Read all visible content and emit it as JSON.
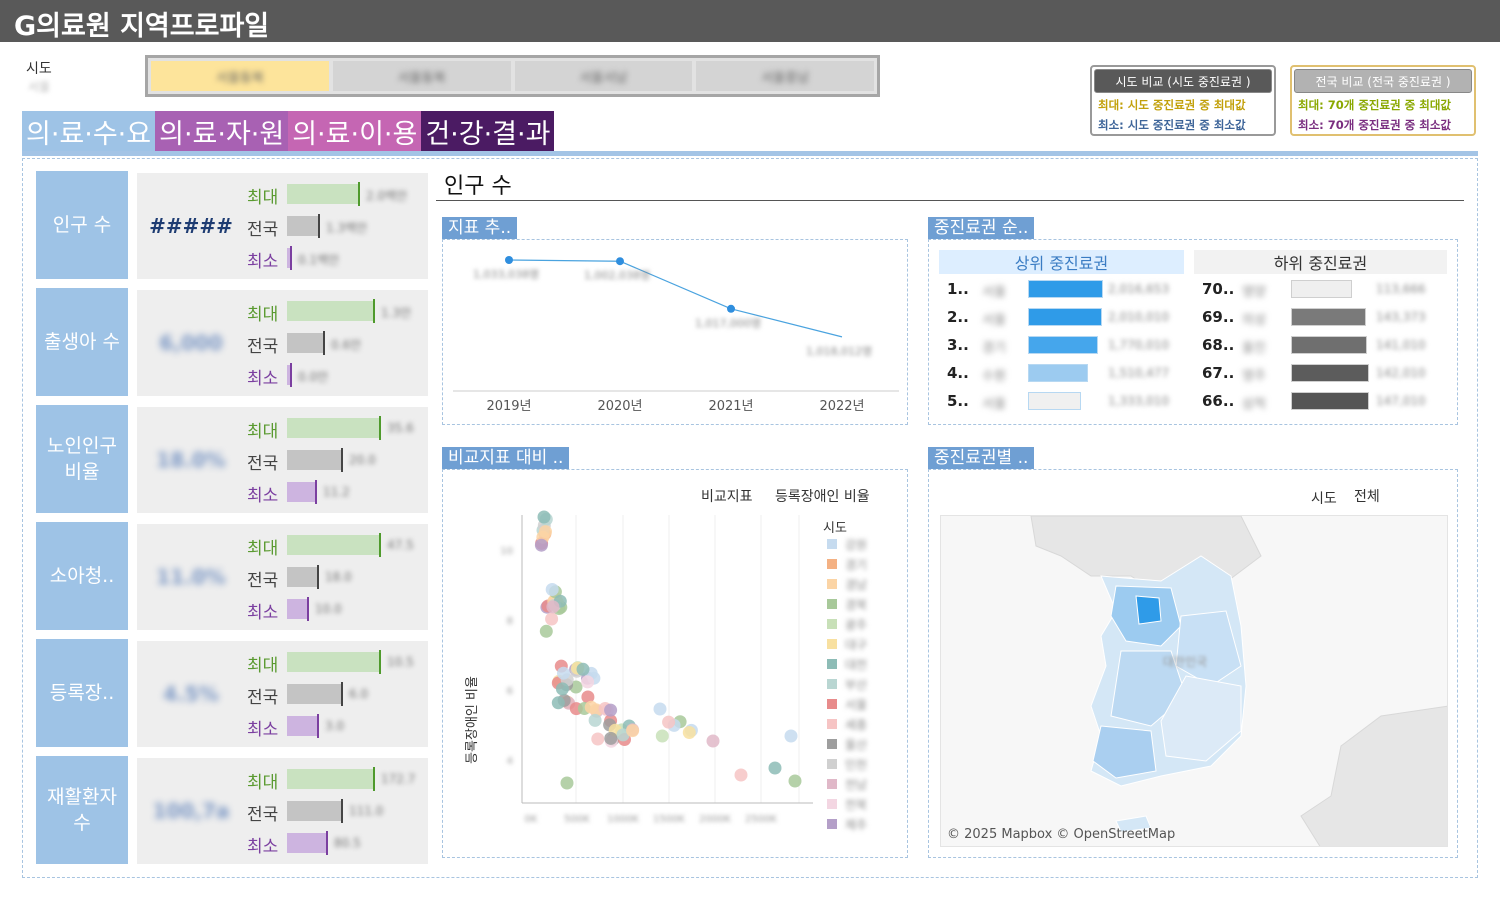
{
  "title": "G의료원 지역프로파일",
  "filter": {
    "label": "시도",
    "value": "서울"
  },
  "sido_tabs": [
    {
      "label": "서울동북",
      "active": true
    },
    {
      "label": "서울동북",
      "active": false
    },
    {
      "label": "서울서남",
      "active": false
    },
    {
      "label": "서울중남",
      "active": false
    }
  ],
  "compare_sido": {
    "header": "시도 비교 (시도 중진료권 )",
    "line_max": "최대: 시도 중진료권 중 최대값",
    "line_min": "최소: 시도 중진료권 중 최소값"
  },
  "compare_nation": {
    "header": "전국 비교 (전국 중진료권 )",
    "line_max": "최대: 70개 중진료권 중 최대값",
    "line_min": "최소: 70개 중진료권 중 최소값"
  },
  "category_tabs": [
    {
      "label": "의·료·수·요",
      "color": "#9ec3e6"
    },
    {
      "label": "의·료·자·원",
      "color": "#a861b3"
    },
    {
      "label": "의·료·이·용",
      "color": "#c566b3"
    },
    {
      "label": "건·강·결·과",
      "color": "#4b1b63"
    }
  ],
  "mm_labels": {
    "max": "최대",
    "nat": "전국",
    "min": "최소"
  },
  "indicators": [
    {
      "label": "인구 수",
      "value": "#####",
      "max_label": "2.0백만",
      "nat_label": "1.3백만",
      "min_label": "0.1백만",
      "max_pct": 0.53,
      "nat_pct": 0.23,
      "min_pct": 0.02
    },
    {
      "label": "출생아 수",
      "value": "6,000",
      "max_label": "1.3만",
      "nat_label": "0.6만",
      "min_label": "0.0만",
      "max_pct": 0.64,
      "nat_pct": 0.27,
      "min_pct": 0.02
    },
    {
      "label": "노인인구 비율",
      "value": "18.0%",
      "max_label": "35.6",
      "nat_label": "20.0",
      "min_label": "11.2",
      "max_pct": 0.68,
      "nat_pct": 0.4,
      "min_pct": 0.21
    },
    {
      "label": "소아청..",
      "value": "11.0%",
      "max_label": "47.5",
      "nat_label": "18.0",
      "min_label": "10.0",
      "max_pct": 0.68,
      "nat_pct": 0.22,
      "min_pct": 0.15
    },
    {
      "label": "등록장..",
      "value": "4.5%",
      "max_label": "10.5",
      "nat_label": "6.0",
      "min_label": "3.0",
      "max_pct": 0.68,
      "nat_pct": 0.4,
      "min_pct": 0.22
    },
    {
      "label": "재활환자 수",
      "value": "100,7a",
      "max_label": "172.7",
      "nat_label": "111.0",
      "min_label": "80.5",
      "max_pct": 0.64,
      "nat_pct": 0.4,
      "min_pct": 0.29
    }
  ],
  "section_title": "인구 수",
  "trend": {
    "header": "지표 추..",
    "chart_data": {
      "type": "line",
      "categories": [
        "2019년",
        "2020년",
        "2021년",
        "2022년"
      ],
      "values": [
        1.0,
        0.99,
        0.6,
        0.37
      ],
      "labels": [
        "1,033,038명",
        "1,002,038명",
        "1,017,000명",
        "1,018,012명"
      ]
    }
  },
  "ranking": {
    "header": "중진료권 순..",
    "top_title": "상위 중진료권",
    "bottom_title": "하위 중진료권",
    "top": [
      {
        "rank": "1..",
        "name": "서울",
        "value": "2,016,653",
        "pct": 1.0,
        "color": "#2f9be8"
      },
      {
        "rank": "2..",
        "name": "서울",
        "value": "2,010,010",
        "pct": 0.98,
        "color": "#2f9be8"
      },
      {
        "rank": "3..",
        "name": "경기",
        "value": "1,770,010",
        "pct": 0.93,
        "color": "#45a6ec"
      },
      {
        "rank": "4..",
        "name": "수원",
        "value": "1,510,477",
        "pct": 0.8,
        "color": "#9ccbf0"
      },
      {
        "rank": "5..",
        "name": "서울",
        "value": "1,333,010",
        "pct": 0.7,
        "color": "#f0f0f0"
      }
    ],
    "bottom": [
      {
        "rank": "70..",
        "name": "영양",
        "value": "113,666",
        "pct": 0.78,
        "color": "#efefef"
      },
      {
        "rank": "69..",
        "name": "의성",
        "value": "143,373",
        "pct": 0.96,
        "color": "#7a7a7a"
      },
      {
        "rank": "68..",
        "name": "울진",
        "value": "141,010",
        "pct": 0.97,
        "color": "#6f6f6f"
      },
      {
        "rank": "67..",
        "name": "영주",
        "value": "142,010",
        "pct": 1.0,
        "color": "#5c5c5c"
      },
      {
        "rank": "66..",
        "name": "삼척",
        "value": "147,010",
        "pct": 1.0,
        "color": "#555555"
      }
    ]
  },
  "scatter": {
    "header": "비교지표 대비 ..",
    "legend_title": "비교지표",
    "legend_value": "등록장애인 비율",
    "legend_series_title": "시도",
    "ylabel": "등록장애인 비율",
    "legend_items": [
      {
        "name": "강원",
        "color": "#c6dbef"
      },
      {
        "name": "경기",
        "color": "#f4b183"
      },
      {
        "name": "경남",
        "color": "#fbd4a5"
      },
      {
        "name": "경북",
        "color": "#a8c99a"
      },
      {
        "name": "광주",
        "color": "#c8e0b8"
      },
      {
        "name": "대구",
        "color": "#f8e0a0"
      },
      {
        "name": "대전",
        "color": "#8dbcb6"
      },
      {
        "name": "부산",
        "color": "#b9d6d2"
      },
      {
        "name": "서울",
        "color": "#e88b8b"
      },
      {
        "name": "세종",
        "color": "#f6c4c4"
      },
      {
        "name": "울산",
        "color": "#9e9e9e"
      },
      {
        "name": "인천",
        "color": "#d0d0d0"
      },
      {
        "name": "전남",
        "color": "#e0b8c8"
      },
      {
        "name": "전북",
        "color": "#f3d6e2"
      },
      {
        "name": "제주",
        "color": "#b49fc8"
      }
    ],
    "x_ticks": [
      "0K",
      "500K",
      "1000K",
      "1500K",
      "2000K",
      "2500K"
    ],
    "y_ticks": [
      "10",
      "8",
      "6",
      "4"
    ]
  },
  "map": {
    "header": "중진료권별 ..",
    "filter_label": "시도",
    "filter_value": "전체",
    "attribution": "© 2025 Mapbox © OpenStreetMap",
    "center_label": "대한민국"
  }
}
